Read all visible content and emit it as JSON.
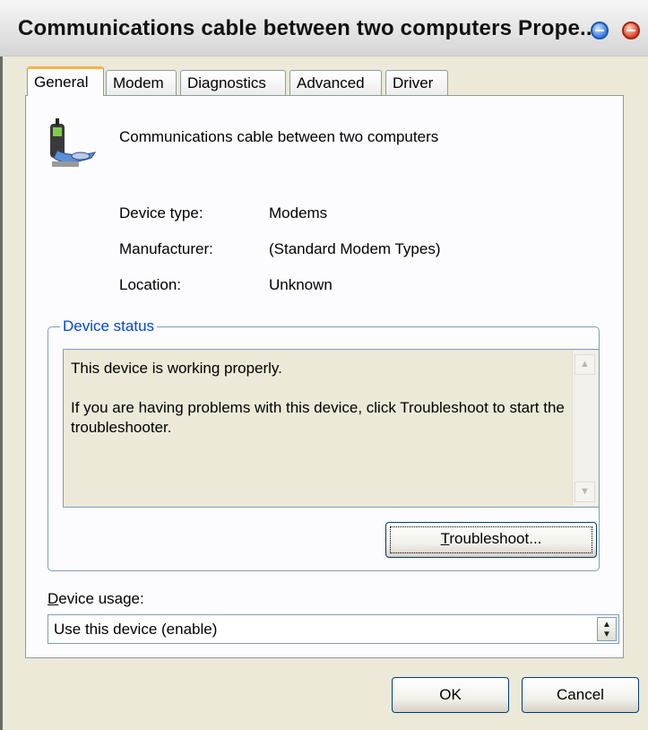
{
  "window": {
    "title": "Communications cable between two computers Prope..."
  },
  "tabs": [
    {
      "label": "General",
      "active": true
    },
    {
      "label": "Modem",
      "active": false
    },
    {
      "label": "Diagnostics",
      "active": false
    },
    {
      "label": "Advanced",
      "active": false
    },
    {
      "label": "Driver",
      "active": false
    }
  ],
  "device": {
    "name": "Communications cable between two computers",
    "icon": "modem-phone-icon",
    "properties": [
      {
        "label": "Device type:",
        "value": "Modems"
      },
      {
        "label": "Manufacturer:",
        "value": "(Standard Modem Types)"
      },
      {
        "label": "Location:",
        "value": "Unknown"
      }
    ]
  },
  "status": {
    "group_label": "Device status",
    "line1": "This device is working properly.",
    "line2": "If you are having problems with this device, click Troubleshoot to start the troubleshooter.",
    "troubleshoot_button": {
      "prefix": "",
      "underlined": "T",
      "rest": "roubleshoot..."
    }
  },
  "usage": {
    "label_underlined": "D",
    "label_rest": "evice usage:",
    "selected": "Use this device (enable)"
  },
  "buttons": {
    "ok": "OK",
    "cancel": "Cancel"
  },
  "colors": {
    "group_label": "#0046d5",
    "active_tab_accent": "#f4b34a"
  }
}
